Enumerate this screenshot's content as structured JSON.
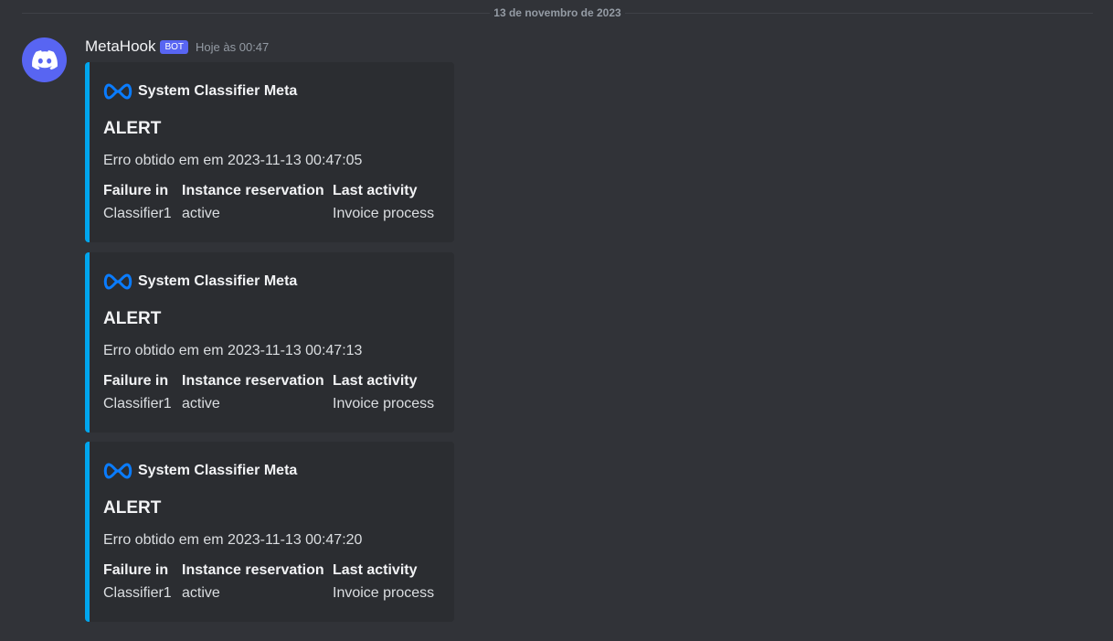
{
  "date_divider": "13 de novembro de 2023",
  "message": {
    "username": "MetaHook",
    "bot_tag": "BOT",
    "timestamp": "Hoje às 00:47",
    "avatar_icon": "discord-logo-icon",
    "accent_color": "#00a6ee",
    "embeds": [
      {
        "author": "System Classifier Meta",
        "author_icon": "meta-logo-icon",
        "title": "ALERT",
        "description": "Erro obtido em em 2023-11-13 00:47:05",
        "fields": [
          {
            "name": "Failure in",
            "value": "Classifier1"
          },
          {
            "name": "Instance reservation",
            "value": "active"
          },
          {
            "name": "Last activity",
            "value": "Invoice process"
          }
        ]
      },
      {
        "author": "System Classifier Meta",
        "author_icon": "meta-logo-icon",
        "title": "ALERT",
        "description": "Erro obtido em em 2023-11-13 00:47:13",
        "fields": [
          {
            "name": "Failure in",
            "value": "Classifier1"
          },
          {
            "name": "Instance reservation",
            "value": "active"
          },
          {
            "name": "Last activity",
            "value": "Invoice process"
          }
        ]
      },
      {
        "author": "System Classifier Meta",
        "author_icon": "meta-logo-icon",
        "title": "ALERT",
        "description": "Erro obtido em em 2023-11-13 00:47:20",
        "fields": [
          {
            "name": "Failure in",
            "value": "Classifier1"
          },
          {
            "name": "Instance reservation",
            "value": "active"
          },
          {
            "name": "Last activity",
            "value": "Invoice process"
          }
        ]
      }
    ]
  }
}
